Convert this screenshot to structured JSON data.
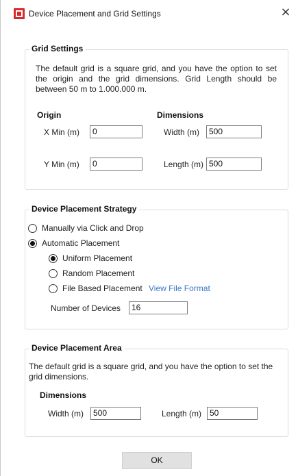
{
  "window": {
    "title": "Device Placement and Grid Settings",
    "close_glyph": "×",
    "app_icon": "app-logo-icon"
  },
  "grid_settings": {
    "title": "Grid Settings",
    "description": "The default grid is a square grid, and you have the option to set the origin and the grid dimensions. Grid Length should be between 50 m to 1.000.000 m.",
    "origin_heading": "Origin",
    "dimensions_heading": "Dimensions",
    "x_min_label": "X Min (m)",
    "x_min_value": "0",
    "y_min_label": "Y Min (m)",
    "y_min_value": "0",
    "width_label": "Width (m)",
    "width_value": "500",
    "length_label": "Length (m)",
    "length_value": "500"
  },
  "placement_strategy": {
    "title": "Device Placement Strategy",
    "manual_label": "Manually via Click and Drop",
    "manual_checked": false,
    "automatic_label": "Automatic Placement",
    "automatic_checked": true,
    "uniform_label": "Uniform Placement",
    "uniform_checked": true,
    "random_label": "Random Placement",
    "random_checked": false,
    "file_label": "File Based Placement",
    "file_checked": false,
    "view_file_format_link": "View File Format",
    "num_devices_label": "Number of Devices",
    "num_devices_value": "16"
  },
  "placement_area": {
    "title": "Device Placement Area",
    "description": "The default grid is a square grid, and you have the option to set the grid dimensions.",
    "dimensions_heading": "Dimensions",
    "width_label": "Width (m)",
    "width_value": "500",
    "length_label": "Length (m)",
    "length_value": "50"
  },
  "footer": {
    "ok_label": "OK"
  },
  "colors": {
    "link": "#3a78c9",
    "icon_red": "#d62b2b",
    "button_bg": "#e1e1e1",
    "group_border": "#dcdcdc"
  }
}
